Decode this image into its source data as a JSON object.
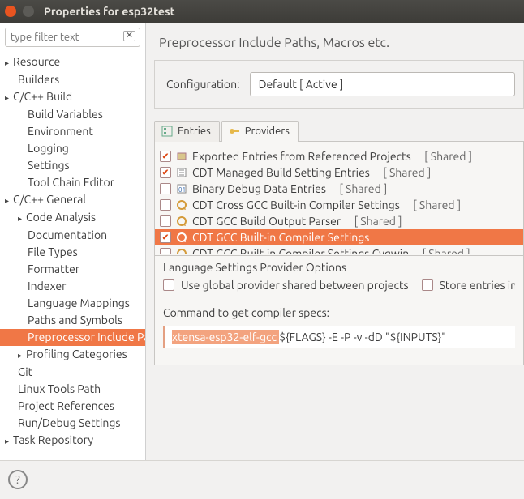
{
  "window": {
    "title": "Properties for esp32test"
  },
  "filter": {
    "placeholder": "type filter text"
  },
  "tree": [
    {
      "label": "Resource",
      "level": 1,
      "arrow": true
    },
    {
      "label": "Builders",
      "level": 2
    },
    {
      "label": "C/C++ Build",
      "level": 1,
      "arrow": true
    },
    {
      "label": "Build Variables",
      "level": 3
    },
    {
      "label": "Environment",
      "level": 3
    },
    {
      "label": "Logging",
      "level": 3
    },
    {
      "label": "Settings",
      "level": 3
    },
    {
      "label": "Tool Chain Editor",
      "level": 3
    },
    {
      "label": "C/C++ General",
      "level": 1,
      "arrow": true
    },
    {
      "label": "Code Analysis",
      "level": 2,
      "arrow": true
    },
    {
      "label": "Documentation",
      "level": 3
    },
    {
      "label": "File Types",
      "level": 3
    },
    {
      "label": "Formatter",
      "level": 3
    },
    {
      "label": "Indexer",
      "level": 3
    },
    {
      "label": "Language Mappings",
      "level": 3
    },
    {
      "label": "Paths and Symbols",
      "level": 3
    },
    {
      "label": "Preprocessor Include Paths, Macros etc.",
      "level": 3,
      "selected": true
    },
    {
      "label": "Profiling Categories",
      "level": 2,
      "arrow": true
    },
    {
      "label": "Git",
      "level": 2
    },
    {
      "label": "Linux Tools Path",
      "level": 2
    },
    {
      "label": "Project References",
      "level": 2
    },
    {
      "label": "Run/Debug Settings",
      "level": 2
    },
    {
      "label": "Task Repository",
      "level": 1,
      "arrow": true
    }
  ],
  "heading": "Preprocessor Include Paths, Macros etc.",
  "config": {
    "label": "Configuration:",
    "value": "Default  [ Active ]"
  },
  "tabs": {
    "entries": "Entries",
    "providers": "Providers"
  },
  "providers": [
    {
      "checked": true,
      "label": "Exported Entries from Referenced Projects",
      "shared": "[ Shared ]"
    },
    {
      "checked": true,
      "label": "CDT Managed Build Setting Entries",
      "shared": "[ Shared ]"
    },
    {
      "checked": false,
      "label": "Binary Debug Data Entries",
      "shared": "[ Shared ]"
    },
    {
      "checked": false,
      "label": "CDT Cross GCC Built-in Compiler Settings",
      "shared": "[ Shared ]"
    },
    {
      "checked": false,
      "label": "CDT GCC Build Output Parser",
      "shared": "[ Shared ]"
    },
    {
      "checked": true,
      "label": "CDT GCC Built-in Compiler Settings",
      "shared": "",
      "selected": true
    },
    {
      "checked": false,
      "label": "CDT GCC Built-in Compiler Settings Cygwin",
      "shared": "[ Shared ]"
    }
  ],
  "options": {
    "title": "Language Settings Provider Options",
    "global": "Use global provider shared between projects",
    "store": "Store entries in project settings folder (easier for version control)"
  },
  "cmd": {
    "label": "Command to get compiler specs:",
    "highlight": "xtensa-esp32-elf-gcc ",
    "rest": "${FLAGS} -E -P -v -dD \"${INPUTS}\""
  }
}
